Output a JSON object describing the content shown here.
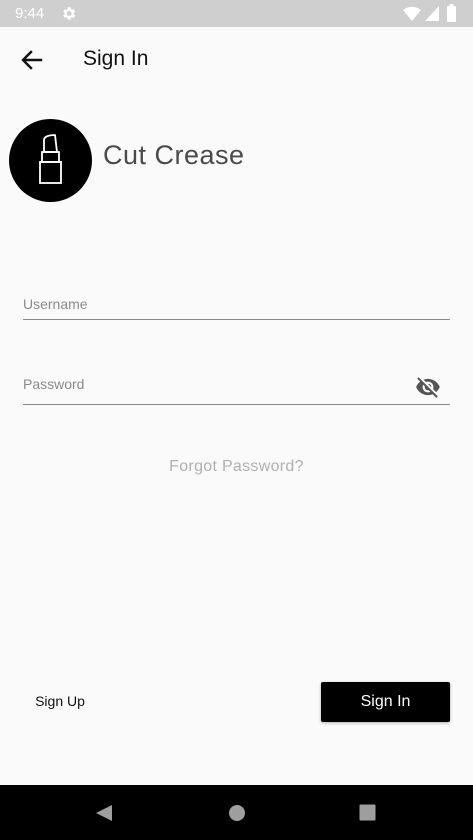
{
  "status_bar": {
    "time": "9:44",
    "icons": [
      "gear-icon",
      "wifi-icon",
      "signal-icon",
      "battery-icon"
    ]
  },
  "app_bar": {
    "title": "Sign In",
    "back_icon": "arrow-left-icon"
  },
  "brand": {
    "name": "Cut Crease",
    "logo_icon": "lipstick-icon"
  },
  "form": {
    "username_placeholder": "Username",
    "username_value": "",
    "password_placeholder": "Password",
    "password_value": "",
    "password_toggle_icon": "eye-off-icon",
    "forgot_password": "Forgot Password?"
  },
  "actions": {
    "sign_up": "Sign Up",
    "sign_in": "Sign In"
  },
  "nav_bar": {
    "icons": [
      "triangle-back-icon",
      "circle-home-icon",
      "square-recents-icon"
    ]
  },
  "colors": {
    "background": "#fafafa",
    "status_bar": "#cfcfcf",
    "primary": "#000000",
    "muted_text": "#b0b0b0"
  }
}
